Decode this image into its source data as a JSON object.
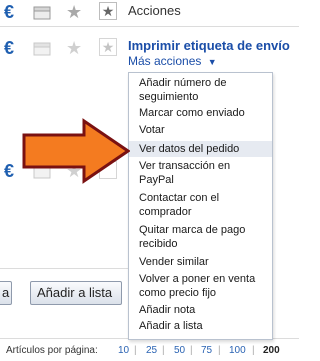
{
  "rows": {
    "top_label": "Acciones",
    "item_title": "Imprimir etiqueta de envío",
    "more_actions": "Más acciones"
  },
  "dropdown": {
    "items": [
      {
        "line1": "Añadir número de",
        "line2": "seguimiento"
      },
      {
        "line1": "Marcar como enviado",
        "line2": ""
      },
      {
        "line1": "Votar",
        "line2": ""
      },
      {
        "line1": "Ver datos del pedido",
        "line2": ""
      },
      {
        "line1": "Ver transacción en",
        "line2": "PayPal"
      },
      {
        "line1": "Contactar con el",
        "line2": "comprador"
      },
      {
        "line1": "Quitar marca de pago",
        "line2": "recibido"
      },
      {
        "line1": "Vender similar",
        "line2": ""
      },
      {
        "line1": "Volver a poner en venta",
        "line2": "como precio fijo"
      },
      {
        "line1": "Añadir nota",
        "line2": ""
      },
      {
        "line1": "Añadir a lista",
        "line2": ""
      }
    ]
  },
  "buttons": {
    "partial_left": "a",
    "add_to_list": "Añadir a lista"
  },
  "pager": {
    "label": "Artículos por página:",
    "options": [
      "10",
      "25",
      "50",
      "75",
      "100",
      "200"
    ],
    "selected": "200"
  },
  "colors": {
    "link": "#1b4ea8",
    "highlight_arrow": "#f47b20",
    "arrow_outline": "#7a1111"
  }
}
